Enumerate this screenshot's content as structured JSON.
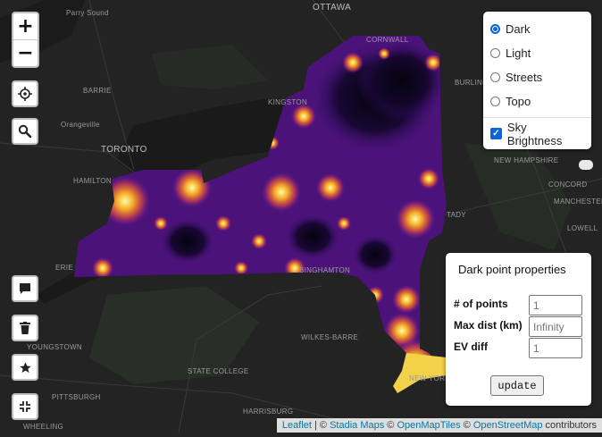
{
  "map": {
    "base_color": "#232323",
    "water_color": "#191919",
    "overlay_dark_color": "#1e0a3c",
    "overlay_mid_color": "#6a1aa0",
    "overlay_hot_color": "#f6a623",
    "overlay_peak_color": "#fcffa4",
    "place_labels": [
      {
        "text": "Parry Sound"
      },
      {
        "text": "OTTAWA"
      },
      {
        "text": "CORNWALL"
      },
      {
        "text": "BARRIE"
      },
      {
        "text": "Orangeville"
      },
      {
        "text": "TORONTO"
      },
      {
        "text": "HAMILTON"
      },
      {
        "text": "KINGSTON"
      },
      {
        "text": "BURLINGTON"
      },
      {
        "text": "NEW HAMPSHIRE"
      },
      {
        "text": "CONCORD"
      },
      {
        "text": "MANCHESTER"
      },
      {
        "text": "TADY"
      },
      {
        "text": "LOWELL"
      },
      {
        "text": "ERIE"
      },
      {
        "text": "YOUNGSTOWN"
      },
      {
        "text": "WILKES-BARRE"
      },
      {
        "text": "STATE COLLEGE"
      },
      {
        "text": "PITTSBURGH"
      },
      {
        "text": "HARRISBURG"
      },
      {
        "text": "WHEELING"
      },
      {
        "text": "BINGHAMTON"
      },
      {
        "text": "NEW YORK"
      }
    ]
  },
  "controls": {
    "zoom_in_label": "+",
    "zoom_out_label": "−",
    "locate_icon": "crosshair-icon",
    "search_icon": "search-icon",
    "comment_icon": "comment-icon",
    "trash_icon": "trash-icon",
    "star_icon": "star-icon",
    "collapse_icon": "collapse-icon"
  },
  "layers": {
    "base_options": [
      {
        "label": "Dark",
        "checked": true
      },
      {
        "label": "Light",
        "checked": false
      },
      {
        "label": "Streets",
        "checked": false
      },
      {
        "label": "Topo",
        "checked": false
      }
    ],
    "overlay_options": [
      {
        "label": "Sky Brightness",
        "checked": true
      }
    ]
  },
  "panel": {
    "title": "Dark point properties",
    "fields": [
      {
        "label": "# of points",
        "placeholder": "1"
      },
      {
        "label": "Max dist (km)",
        "placeholder": "Infinity"
      },
      {
        "label": "EV diff",
        "placeholder": "1"
      }
    ],
    "update_label": "update"
  },
  "attribution": {
    "leaflet": "Leaflet",
    "sep1": " | © ",
    "stadia": "Stadia Maps",
    "sep2": " © ",
    "openmaptiles": "OpenMapTiles",
    "sep3": " © ",
    "osm": "OpenStreetMap",
    "suffix": " contributors"
  }
}
